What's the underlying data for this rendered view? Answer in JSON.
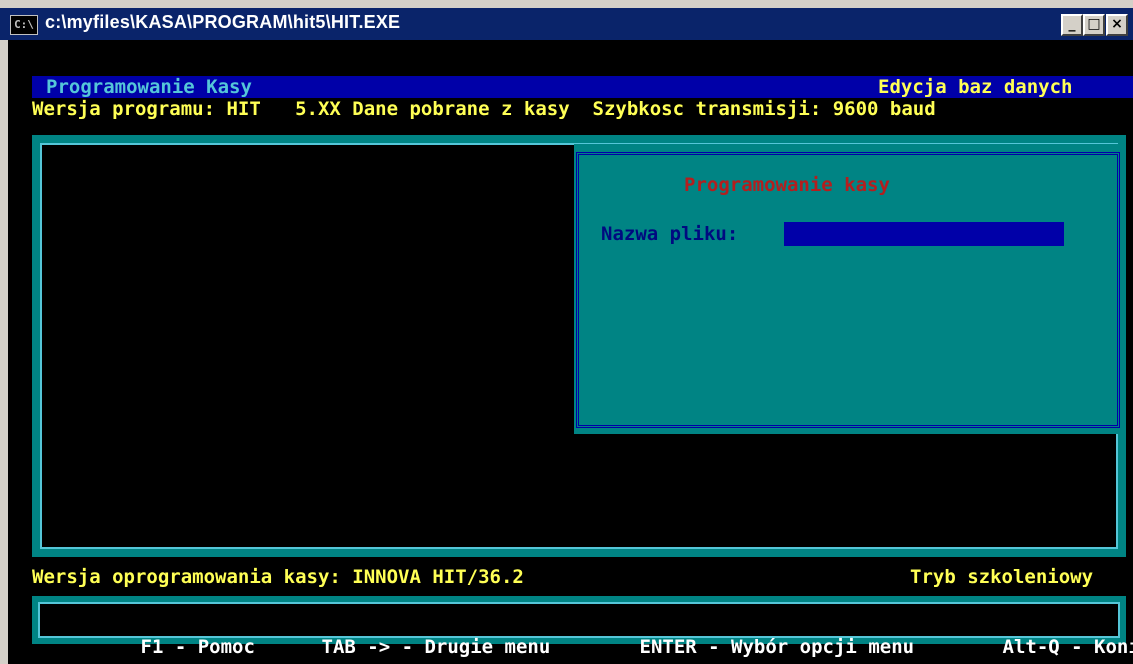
{
  "window": {
    "title": "c:\\myfiles\\KASA\\PROGRAM\\hit5\\HIT.EXE",
    "icon": "C:\\",
    "minimize_glyph": "_",
    "maximize_glyph": "□",
    "close_glyph": "×"
  },
  "menubar": {
    "left_label": "Programowanie Kasy",
    "right_label": "Edycja baz danych"
  },
  "info": {
    "line": "Wersja programu: HIT   5.XX Dane pobrane z kasy  Szybkosc transmisji: 9600 baud"
  },
  "dialog": {
    "title": "Programowanie kasy",
    "field_label": "Nazwa pliku:",
    "field_value": ""
  },
  "status": {
    "left": "Wersja oprogramowania kasy: INNOVA HIT/36.2",
    "right": "Tryb szkoleniowy"
  },
  "keys": [
    {
      "key": "F1",
      "sep": " - ",
      "label": "Pomoc"
    },
    {
      "key": "TAB ->",
      "sep": " - ",
      "label": "Drugie menu"
    },
    {
      "key": "ENTER",
      "sep": " - ",
      "label": "Wybór opcji menu"
    },
    {
      "key": "Alt-Q",
      "sep": " - ",
      "label": "Koniec"
    }
  ],
  "colors": {
    "title_bar": "#0a246a",
    "dos_blue": "#0000a8",
    "dos_cyan": "#008484",
    "dos_yellow": "#ffff55",
    "dos_red": "#b41e1e"
  }
}
